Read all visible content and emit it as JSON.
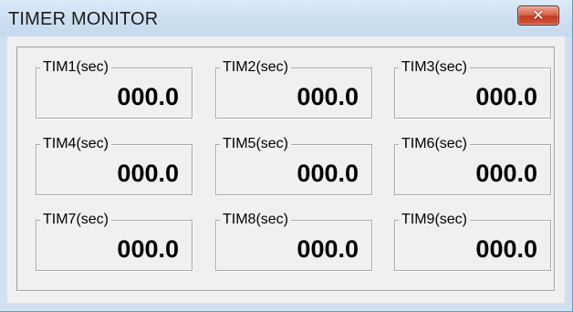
{
  "window": {
    "title": "TIMER MONITOR",
    "close_icon": "close-icon"
  },
  "timers": [
    {
      "label": "TIM1(sec)",
      "value": "000.0"
    },
    {
      "label": "TIM2(sec)",
      "value": "000.0"
    },
    {
      "label": "TIM3(sec)",
      "value": "000.0"
    },
    {
      "label": "TIM4(sec)",
      "value": "000.0"
    },
    {
      "label": "TIM5(sec)",
      "value": "000.0"
    },
    {
      "label": "TIM6(sec)",
      "value": "000.0"
    },
    {
      "label": "TIM7(sec)",
      "value": "000.0"
    },
    {
      "label": "TIM8(sec)",
      "value": "000.0"
    },
    {
      "label": "TIM9(sec)",
      "value": "000.0"
    }
  ]
}
